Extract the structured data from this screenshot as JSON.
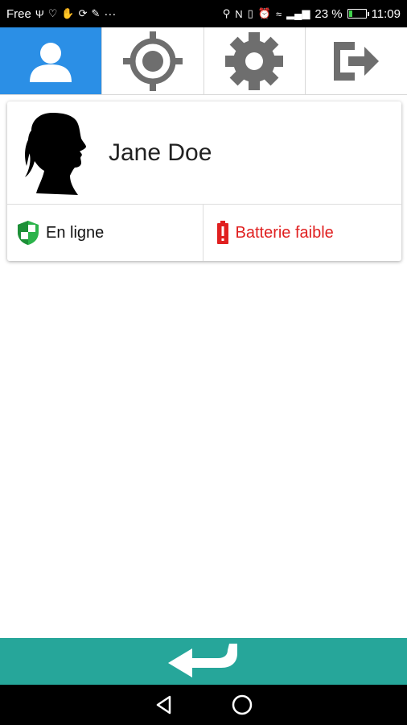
{
  "status_bar": {
    "carrier": "Free",
    "left_icons": [
      "usb-icon",
      "heart-icon",
      "hand-icon",
      "sync-icon",
      "edit-icon"
    ],
    "more": "···",
    "battery_percent": "23 %",
    "battery_level": 0.23,
    "time": "11:09"
  },
  "tabs": [
    {
      "name": "profile",
      "icon": "person-icon",
      "active": true
    },
    {
      "name": "location",
      "icon": "crosshair-icon",
      "active": false
    },
    {
      "name": "settings",
      "icon": "gear-icon",
      "active": false
    },
    {
      "name": "logout",
      "icon": "exit-icon",
      "active": false
    }
  ],
  "card": {
    "name": "Jane Doe",
    "online_status": "En ligne",
    "battery_status": "Batterie faible"
  },
  "colors": {
    "active_tab": "#2b8fe6",
    "back_bar": "#26a69a",
    "online_green": "#2bb34a",
    "alert_red": "#e02020"
  }
}
